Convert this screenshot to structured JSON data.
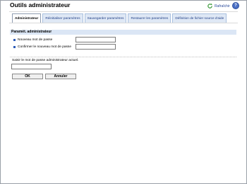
{
  "app": {
    "title": "Outils administrateur",
    "refresh_label": "Rafraîchir",
    "help_label": "?"
  },
  "tabs": [
    {
      "label": "Administrateur",
      "active": true
    },
    {
      "label": "Réinitialiser paramètres",
      "active": false
    },
    {
      "label": "Sauvegarder paramètres",
      "active": false
    },
    {
      "label": "Restaurer les paramètres",
      "active": false
    },
    {
      "label": "Définition de fichier source d'aide",
      "active": false
    }
  ],
  "section": {
    "title": "Paramét. administrateur",
    "fields": [
      {
        "label": "Nouveau mot de passe",
        "value": ""
      },
      {
        "label": "Confirmer le nouveau mot de passe",
        "value": ""
      }
    ]
  },
  "current_password": {
    "label": "Saisir le mot de passe administrateur actuel.",
    "value": ""
  },
  "buttons": {
    "ok": "OK",
    "cancel": "Annuler"
  },
  "colors": {
    "accent": "#2e5cb8",
    "tab_bg": "#dfe8f5",
    "section_bg": "#dbe6f5"
  }
}
